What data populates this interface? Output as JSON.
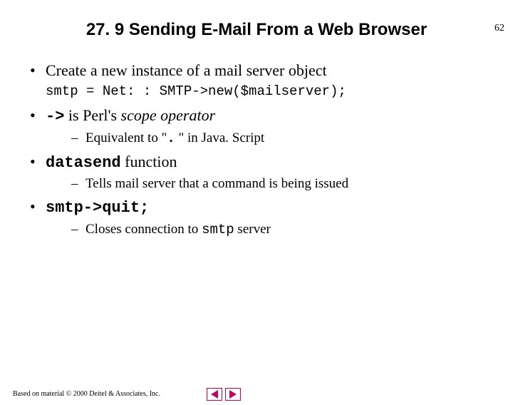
{
  "pageNumber": "62",
  "title": "27. 9 Sending E-Mail From a Web Browser",
  "bullets": {
    "b1": "Create a new instance of a mail server object",
    "code1": "smtp = Net: : SMTP->new($mailserver);",
    "b2_code": "->",
    "b2_mid": " is Perl's ",
    "b2_italic": "scope operator",
    "b2_sub_pre": "Equivalent to \"",
    "b2_sub_code": ".",
    "b2_sub_post": " \" in Java. Script",
    "b3_code": "datasend",
    "b3_text": " function",
    "b3_sub": "Tells mail server that a command is being issued",
    "b4_code": "smtp->quit;",
    "b4_sub_pre": "Closes connection to ",
    "b4_sub_code": "smtp",
    "b4_sub_post": " server"
  },
  "footer": "Based on material © 2000 Deitel & Associates, Inc.",
  "nav": {
    "prev": "previous-slide",
    "next": "next-slide"
  }
}
